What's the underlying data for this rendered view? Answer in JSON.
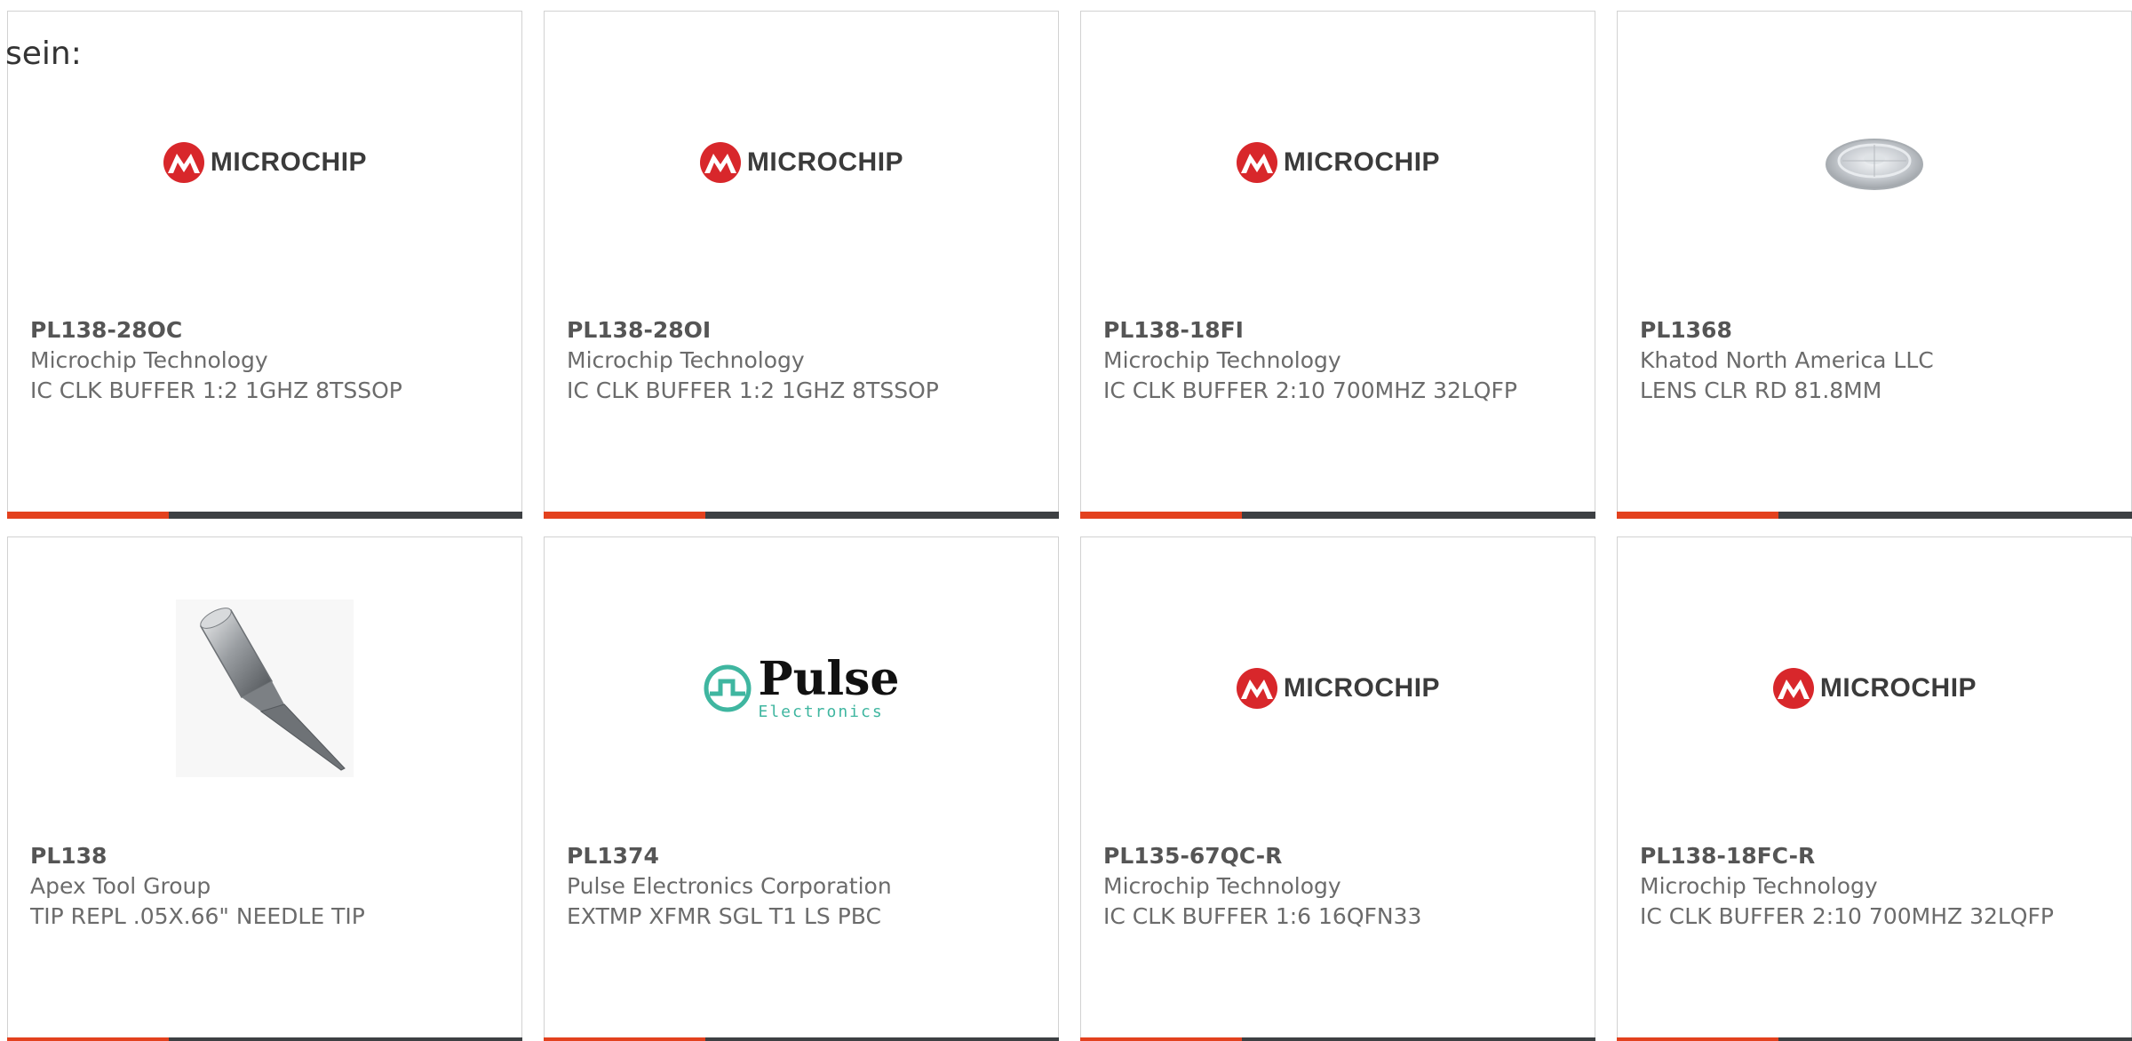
{
  "intro_text": "sein:",
  "products": [
    {
      "part": "PL138-28OC",
      "maker": "Microchip Technology",
      "desc": "IC CLK BUFFER 1:2 1GHZ 8TSSOP",
      "image": "microchip-logo",
      "logo_word": "MICROCHIP"
    },
    {
      "part": "PL138-28OI",
      "maker": "Microchip Technology",
      "desc": "IC CLK BUFFER 1:2 1GHZ 8TSSOP",
      "image": "microchip-logo",
      "logo_word": "MICROCHIP"
    },
    {
      "part": "PL138-18FI",
      "maker": "Microchip Technology",
      "desc": "IC CLK BUFFER 2:10 700MHZ 32LQFP",
      "image": "microchip-logo",
      "logo_word": "MICROCHIP"
    },
    {
      "part": "PL1368",
      "maker": "Khatod North America LLC",
      "desc": "LENS CLR RD 81.8MM",
      "image": "lens-photo"
    },
    {
      "part": "PL138",
      "maker": "Apex Tool Group",
      "desc": "TIP REPL .05X.66\" NEEDLE TIP",
      "image": "needle-tip-photo"
    },
    {
      "part": "PL1374",
      "maker": "Pulse Electronics Corporation",
      "desc": "EXTMP XFMR SGL T1 LS PBC",
      "image": "pulse-logo",
      "logo_main": "Pulse",
      "logo_sub": "Electronics"
    },
    {
      "part": "PL135-67QC-R",
      "maker": "Microchip Technology",
      "desc": "IC CLK BUFFER 1:6 16QFN33",
      "image": "microchip-logo",
      "logo_word": "MICROCHIP"
    },
    {
      "part": "PL138-18FC-R",
      "maker": "Microchip Technology",
      "desc": "IC CLK BUFFER 2:10 700MHZ 32LQFP",
      "image": "microchip-logo",
      "logo_word": "MICROCHIP"
    }
  ],
  "colors": {
    "accent_bar": "#e3411e",
    "dark_bar": "#3d4043",
    "microchip_red": "#d8272b",
    "pulse_teal": "#3fb6a0"
  }
}
